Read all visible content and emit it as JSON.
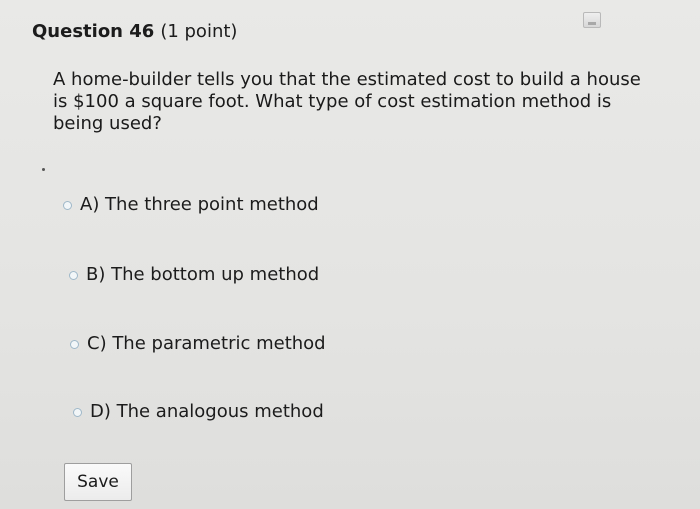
{
  "question": {
    "title": "Question 46",
    "points": "(1 point)",
    "prompt": "A home-builder tells you that the estimated cost to build a house is $100 a square foot. What type of cost estimation method is being used?"
  },
  "options": [
    {
      "label": "A) The three point method"
    },
    {
      "label": "B) The bottom up method"
    },
    {
      "label": "C) The parametric method"
    },
    {
      "label": "D) The analogous method"
    }
  ],
  "actions": {
    "save_label": "Save"
  },
  "icons": {
    "flag": "flag-question-icon"
  },
  "colors": {
    "background": "#e6e6e4",
    "text": "#1c1c1c",
    "radio_border": "#9fb8c9"
  }
}
